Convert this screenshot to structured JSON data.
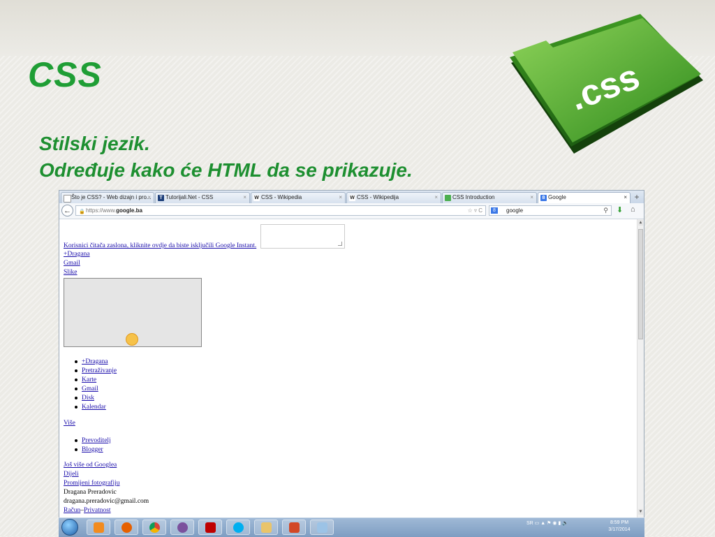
{
  "slide": {
    "title": "CSS",
    "line1": "Stilski jezik.",
    "line2": "Određuje kako će HTML da se prikazuje.",
    "folder_label": ".css",
    "accent_color": "#1f9e35"
  },
  "browser": {
    "tabs": [
      {
        "label": "Što je CSS? - Web dizajn i pro...",
        "icon": "page-icon"
      },
      {
        "label": "Tutorijali.Net - CSS",
        "icon": "tutorijali-icon"
      },
      {
        "label": "CSS - Wikipedia",
        "icon": "wikipedia-icon"
      },
      {
        "label": "CSS - Wikipedija",
        "icon": "wikipedia-icon"
      },
      {
        "label": "CSS Introduction",
        "icon": "w3schools-icon"
      },
      {
        "label": "Google",
        "icon": "google-icon",
        "active": true
      }
    ],
    "close_glyph": "×",
    "new_tab_glyph": "+",
    "url_prefix": "https://www.",
    "url_domain": "google.ba",
    "url_icons": "☆ ▿ C",
    "search_engine_letter": "8",
    "search_value": "google"
  },
  "page": {
    "instant_link": "Korisnici čitača zaslona, kliknite ovdje da biste isključili Google Instant.",
    "top_links": [
      "+Dragana",
      "Gmail",
      "Slike"
    ],
    "apps_list": [
      "+Dragana",
      "Pretraživanje",
      "Karte",
      "Gmail",
      "Disk",
      "Kalendar"
    ],
    "more_link": "Više",
    "more_list": [
      "Prevoditelj",
      "Blogger"
    ],
    "more_from_google": "Još više od Googlea",
    "share": "Dijeli",
    "change_photo": "Promijeni fotografiju",
    "user_name": "Dragana Preradovic",
    "user_email": "dragana.preradovic@gmail.com",
    "account": "Račun",
    "privacy": "Privatnost"
  },
  "taskbar": {
    "apps": [
      "media-player-icon",
      "firefox-icon",
      "chrome-icon",
      "viber-icon",
      "filezilla-icon",
      "skype-icon",
      "explorer-icon",
      "powerpoint-icon",
      "paint-icon"
    ],
    "language": "SR",
    "time": "8:59 PM",
    "date": "3/17/2014"
  }
}
